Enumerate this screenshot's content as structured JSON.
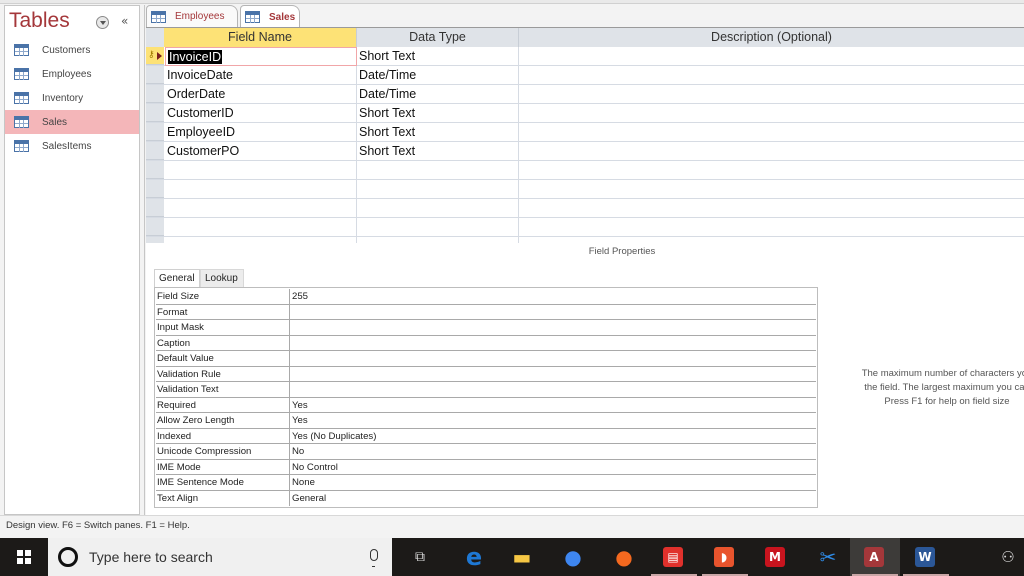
{
  "nav": {
    "title": "Tables",
    "collapse_glyph": "«",
    "items": [
      {
        "label": "Customers",
        "active": false
      },
      {
        "label": "Employees",
        "active": false
      },
      {
        "label": "Inventory",
        "active": false
      },
      {
        "label": "Sales",
        "active": true
      },
      {
        "label": "SalesItems",
        "active": false
      }
    ]
  },
  "tabs": [
    {
      "label": "Employees",
      "active": false
    },
    {
      "label": "Sales",
      "active": true
    }
  ],
  "grid": {
    "headers": {
      "field": "Field Name",
      "dtype": "Data Type",
      "desc": "Description (Optional)"
    },
    "rows": [
      {
        "field": "InvoiceID",
        "dtype": "Short Text",
        "desc": "",
        "primary_key": true,
        "current": true
      },
      {
        "field": "InvoiceDate",
        "dtype": "Date/Time",
        "desc": ""
      },
      {
        "field": "OrderDate",
        "dtype": "Date/Time",
        "desc": ""
      },
      {
        "field": "CustomerID",
        "dtype": "Short Text",
        "desc": ""
      },
      {
        "field": "EmployeeID",
        "dtype": "Short Text",
        "desc": ""
      },
      {
        "field": "CustomerPO",
        "dtype": "Short Text",
        "desc": ""
      }
    ],
    "empty_rows": 5
  },
  "field_properties": {
    "title": "Field Properties",
    "tabs": [
      "General",
      "Lookup"
    ],
    "properties": [
      {
        "name": "Field Size",
        "value": "255"
      },
      {
        "name": "Format",
        "value": ""
      },
      {
        "name": "Input Mask",
        "value": ""
      },
      {
        "name": "Caption",
        "value": ""
      },
      {
        "name": "Default Value",
        "value": ""
      },
      {
        "name": "Validation Rule",
        "value": ""
      },
      {
        "name": "Validation Text",
        "value": ""
      },
      {
        "name": "Required",
        "value": "Yes"
      },
      {
        "name": "Allow Zero Length",
        "value": "Yes"
      },
      {
        "name": "Indexed",
        "value": "Yes (No Duplicates)"
      },
      {
        "name": "Unicode Compression",
        "value": "No"
      },
      {
        "name": "IME Mode",
        "value": "No Control"
      },
      {
        "name": "IME Sentence Mode",
        "value": "None"
      },
      {
        "name": "Text Align",
        "value": "General"
      }
    ],
    "help_lines": [
      "The maximum number of characters you",
      "the field. The largest maximum you can",
      "Press F1 for help on field size"
    ]
  },
  "status_bar": {
    "text": "Design view.  F6 = Switch panes.  F1 = Help."
  },
  "taskbar": {
    "search_placeholder": "Type here to search",
    "apps": [
      {
        "name": "task-view",
        "glyph": "⧉"
      },
      {
        "name": "edge",
        "glyph": "e",
        "color": "#1e78d4"
      },
      {
        "name": "file-explorer",
        "glyph": "▬",
        "color": "#f6c744"
      },
      {
        "name": "chrome",
        "glyph": "●",
        "color": "#3e86f0"
      },
      {
        "name": "firefox",
        "glyph": "●",
        "color": "#f4691f"
      },
      {
        "name": "reader",
        "glyph": "▤",
        "color": "#e0312c"
      },
      {
        "name": "app-orange",
        "glyph": "◗",
        "color": "#e8542d"
      },
      {
        "name": "mcafee",
        "glyph": "M",
        "color": "#c8141e"
      },
      {
        "name": "snipping-tool",
        "glyph": "✂",
        "color": "#2f8be6"
      },
      {
        "name": "access",
        "glyph": "A",
        "color": "#a4373a",
        "active": true
      },
      {
        "name": "word",
        "glyph": "W",
        "color": "#2b5797"
      }
    ],
    "people_glyph": "⚇"
  }
}
